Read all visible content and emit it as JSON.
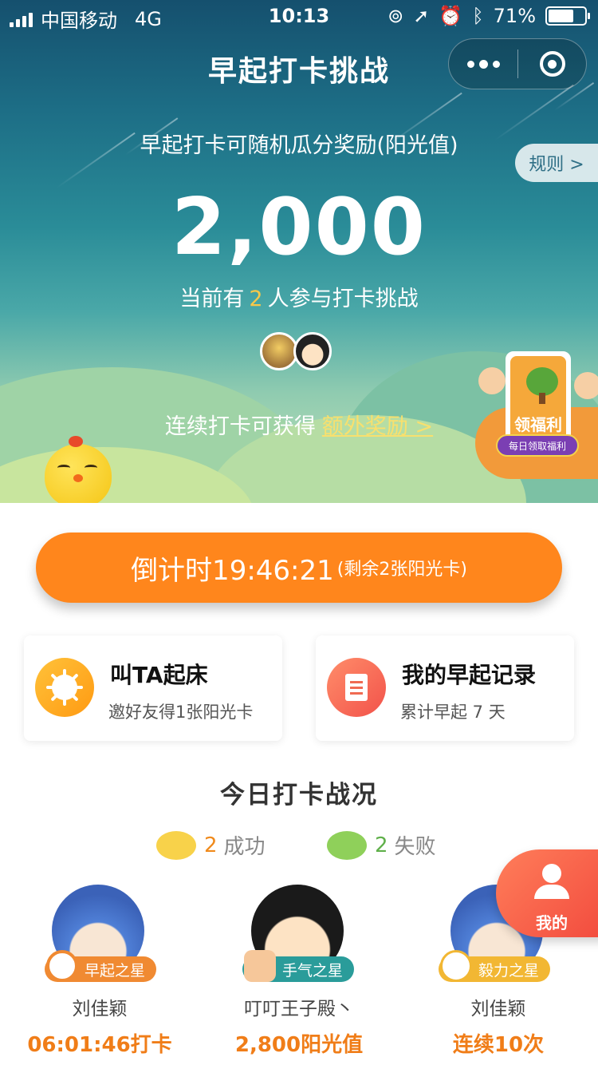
{
  "statusbar": {
    "carrier": "中国移动",
    "network": "4G",
    "time": "10:13",
    "battery": "71%",
    "battery_level": 0.71
  },
  "nav": {
    "title": "早起打卡挑战"
  },
  "hero": {
    "subtitle": "早起打卡可随机瓜分奖励(阳光值)",
    "rules_label": "规则 >",
    "reward_amount": "2,000",
    "participants_prefix": "当前有",
    "participants_count": "2",
    "participants_suffix": "人参与打卡挑战",
    "streak_prefix": "连续打卡可获得",
    "streak_link": "额外奖励 >",
    "welfare_label": "领福利",
    "welfare_pill": "每日领取福利"
  },
  "countdown": {
    "label": "倒计时19:46:21",
    "remaining": "(剩余2张阳光卡)"
  },
  "cards": [
    {
      "title": "叫TA起床",
      "subtitle": "邀好友得1张阳光卡"
    },
    {
      "title": "我的早起记录",
      "subtitle": "累计早起 7 天"
    }
  ],
  "today": {
    "title": "今日打卡战况",
    "success_count": "2",
    "success_label": "成功",
    "fail_count": "2",
    "fail_label": "失败"
  },
  "fab": {
    "label": "我的"
  },
  "stars": [
    {
      "badge": "早起之星",
      "name": "刘佳颖",
      "value": "06:01:46打卡"
    },
    {
      "badge": "手气之星",
      "name": "叮叮王子殿丶",
      "value": "2,800阳光值"
    },
    {
      "badge": "毅力之星",
      "name": "刘佳颖",
      "value": "连续10次"
    }
  ],
  "colors": {
    "accent_orange": "#ff861c",
    "highlight_yellow": "#f7c84a",
    "success": "#f08a1c",
    "fail": "#5fb04a"
  }
}
